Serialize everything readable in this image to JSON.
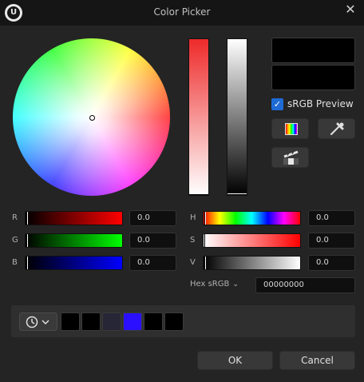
{
  "window": {
    "title": "Color Picker",
    "logo_text": "U",
    "close_glyph": "✕"
  },
  "preview": {
    "new_color": "#000000",
    "old_color": "#000000"
  },
  "srgb_preview": {
    "label": "sRGB Preview",
    "checked": true,
    "check_glyph": "✓"
  },
  "icons": {
    "spectrum": "color-spectrum-icon",
    "dropper": "eyedropper-icon",
    "theme": "color-themes-icon",
    "history": "clock-icon",
    "chevron": "chevron-down-icon"
  },
  "channels": {
    "r": {
      "label": "R",
      "value": "0.0"
    },
    "g": {
      "label": "G",
      "value": "0.0"
    },
    "b": {
      "label": "B",
      "value": "0.0"
    },
    "h": {
      "label": "H",
      "value": "0.0"
    },
    "s": {
      "label": "S",
      "value": "0.0"
    },
    "v": {
      "label": "V",
      "value": "0.0"
    }
  },
  "hex": {
    "label": "Hex sRGB",
    "chevron_glyph": "⌄",
    "value": "00000000"
  },
  "history_swatches": [
    "#000000",
    "#000000",
    "#262636",
    "#2a10ff",
    "#000000",
    "#000000"
  ],
  "buttons": {
    "ok": "OK",
    "cancel": "Cancel"
  }
}
